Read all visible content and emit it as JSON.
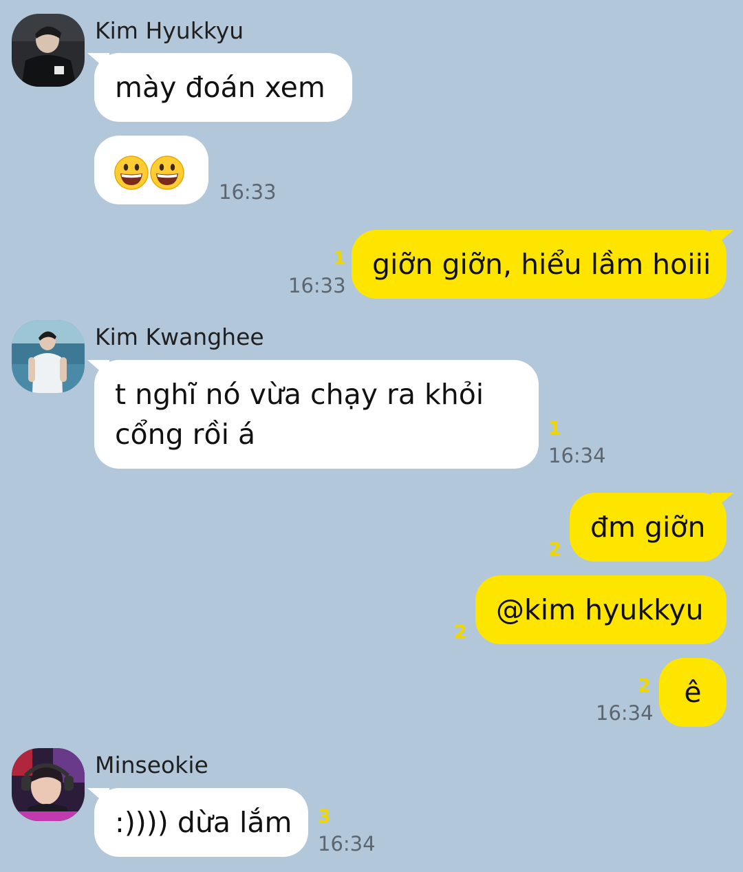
{
  "messages": [
    {
      "sender": "Kim Hyukkyu",
      "bubbles": [
        {
          "text": "mày đoán xem"
        },
        {
          "emoji": [
            "grinning-face-emoji",
            "grinning-face-emoji"
          ]
        }
      ],
      "time": "16:33"
    },
    {
      "sender": "me",
      "bubbles": [
        {
          "text": "giỡn giỡn, hiểu lầm hoiii",
          "unread": "1"
        }
      ],
      "time": "16:33"
    },
    {
      "sender": "Kim Kwanghee",
      "bubbles": [
        {
          "text_lines": [
            "t nghĩ nó vừa chạy ra khỏi",
            "cổng rồi á"
          ],
          "unread": "1"
        }
      ],
      "time": "16:34"
    },
    {
      "sender": "me",
      "bubbles": [
        {
          "text": "đm giỡn",
          "unread": "2"
        },
        {
          "text": "@kim hyukkyu",
          "unread": "2"
        },
        {
          "text": "ê",
          "unread": "2"
        }
      ],
      "time": "16:34"
    },
    {
      "sender": "Minseokie",
      "bubbles": [
        {
          "text": ":)))) dừa lắm",
          "unread": "3"
        }
      ],
      "time": "16:34"
    }
  ],
  "colors": {
    "background": "#b2c7da",
    "incoming_bubble": "#ffffff",
    "outgoing_bubble": "#fee500",
    "unread_count": "#f0d600",
    "timestamp": "#5c6670"
  }
}
